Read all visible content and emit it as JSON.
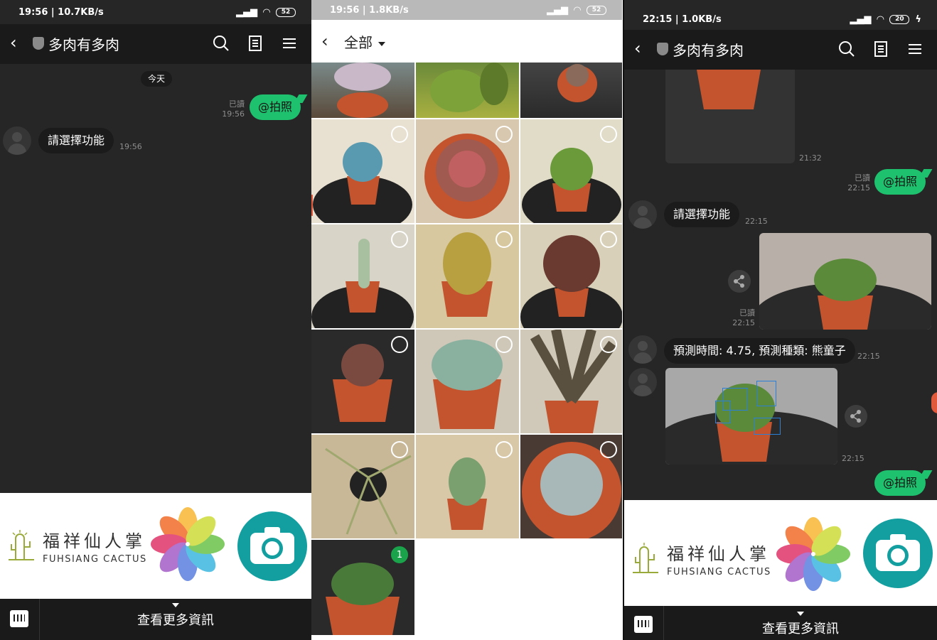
{
  "left": {
    "status": {
      "time": "19:56 | 10.7KB/s",
      "battery": "52"
    },
    "header": {
      "title": "多肉有多肉"
    },
    "day": "今天",
    "messages": [
      {
        "dir": "out",
        "text": "@拍照",
        "read": "已讀",
        "time": "19:56"
      },
      {
        "dir": "in",
        "text": "請選擇功能",
        "time": "19:56"
      }
    ]
  },
  "gallery": {
    "status": {
      "time": "19:56 | 1.8KB/s",
      "battery": "52"
    },
    "title": "全部",
    "selected_count": "1"
  },
  "right": {
    "status": {
      "time": "22:15 | 1.0KB/s",
      "battery": "20"
    },
    "header": {
      "title": "多肉有多肉"
    },
    "messages": {
      "img_time": "21:32",
      "out1": {
        "text": "@拍照",
        "read": "已讀",
        "time": "22:15"
      },
      "in1": {
        "text": "請選擇功能",
        "time": "22:15"
      },
      "photo_meta": {
        "read": "已讀",
        "time": "22:15"
      },
      "prediction": {
        "text": "預測時間: 4.75, 預測種類: 熊童子",
        "time": "22:15"
      },
      "detect_time": "22:15",
      "out2": {
        "text": "@拍照"
      }
    }
  },
  "menu": {
    "brand_zh": "福祥仙人掌",
    "brand_en": "FUHSIANG CACTUS",
    "more_info": "查看更多資訊"
  },
  "colors": {
    "line_green": "#1ec16e",
    "teal": "#139fa0",
    "dark_bg": "#262626"
  },
  "icons": [
    "back-icon",
    "search-icon",
    "notes-icon",
    "menu-icon",
    "keyboard-icon",
    "camera-icon",
    "photos-icon",
    "share-icon"
  ]
}
